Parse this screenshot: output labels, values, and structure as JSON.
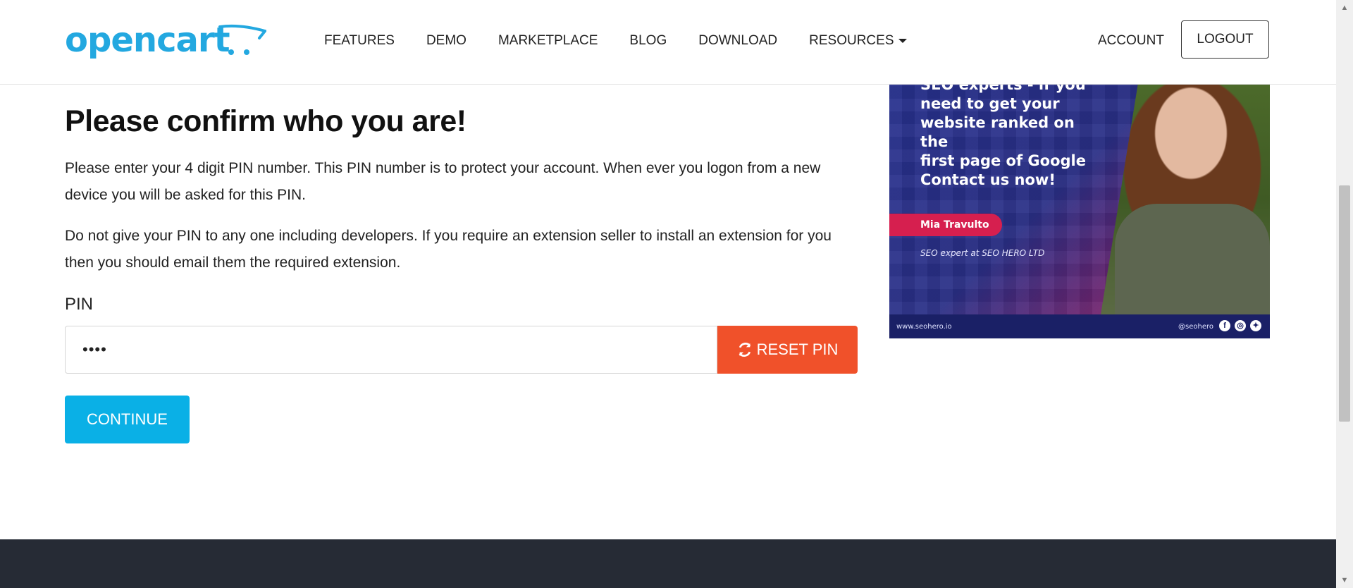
{
  "header": {
    "logo_text": "opencart",
    "nav": [
      {
        "label": "FEATURES"
      },
      {
        "label": "DEMO"
      },
      {
        "label": "MARKETPLACE"
      },
      {
        "label": "BLOG"
      },
      {
        "label": "DOWNLOAD"
      },
      {
        "label": "RESOURCES"
      }
    ],
    "account_label": "ACCOUNT",
    "logout_label": "LOGOUT"
  },
  "main": {
    "title": "Please confirm who you are!",
    "paragraph1": "Please enter your 4 digit PIN number. This PIN number is to protect your account. When ever you logon from a new device you will be asked for this PIN.",
    "paragraph2": "Do not give your PIN to any one including developers. If you require an extension seller to install an extension for you then you should email them the required extension.",
    "pin_label": "PIN",
    "pin_value": "••••",
    "reset_label": "RESET PIN",
    "continue_label": "CONTINUE"
  },
  "ad": {
    "headline_line1": "SEO experts - if you",
    "headline_line2": "need to get your",
    "headline_line3": "website ranked on the",
    "headline_line4": "first page of Google",
    "headline_line5": "Contact us now!",
    "name": "Mia Travulto",
    "role": "SEO expert at SEO HERO LTD",
    "url": "www.seohero.io",
    "handle": "@seohero"
  },
  "colors": {
    "brand": "#23a8e0",
    "reset_button": "#f0512a",
    "continue_button": "#0ab0e6",
    "footer": "#262b35"
  },
  "icons": {
    "reset": "refresh-icon",
    "resources_caret": "caret-down-icon"
  }
}
